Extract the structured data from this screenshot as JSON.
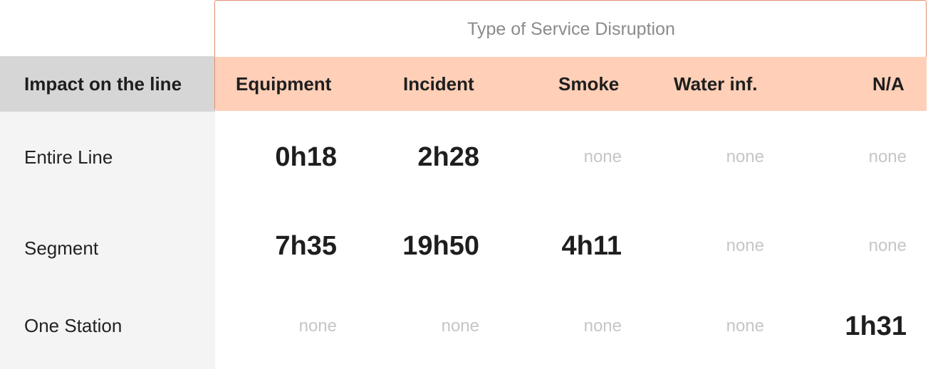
{
  "chart_data": {
    "type": "table",
    "title": "Type of Service Disruption",
    "row_header": "Impact on the line",
    "columns": [
      "Equipment",
      "Incident",
      "Smoke",
      "Water inf.",
      "N/A"
    ],
    "rows": [
      {
        "label": "Entire Line",
        "values": [
          "0h18",
          "2h28",
          "none",
          "none",
          "none"
        ]
      },
      {
        "label": "Segment",
        "values": [
          "7h35",
          "19h50",
          "4h11",
          "none",
          "none"
        ]
      },
      {
        "label": "One Station",
        "values": [
          "none",
          "none",
          "none",
          "none",
          "1h31"
        ]
      }
    ],
    "colors": {
      "header_band": "#ffcfb7",
      "header_border": "#e28f6c",
      "row_header_bg": "#d6d6d6",
      "row_label_bg": "#f4f4f4",
      "value_text": "#1e1e1e",
      "none_text": "#c6c6c6"
    }
  }
}
